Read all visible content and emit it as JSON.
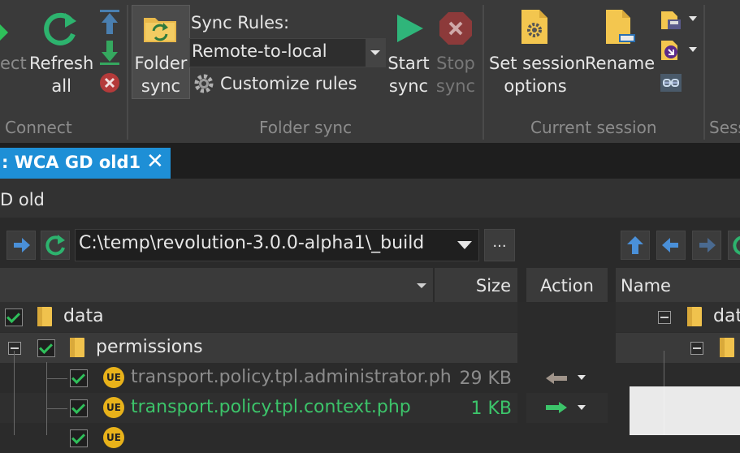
{
  "ribbon": {
    "connect_partial": "ect",
    "refresh_line1": "Refresh",
    "refresh_line2": "all",
    "folder_sync_line1": "Folder",
    "folder_sync_line2": "sync",
    "sync_rules_label": "Sync Rules:",
    "sync_rules_value": "Remote-to-local",
    "customize_rules": "Customize rules",
    "start_sync_line1": "Start",
    "start_sync_line2": "sync",
    "stop_sync_line1": "Stop",
    "stop_sync_line2": "sync",
    "set_session_line1": "Set session",
    "set_session_line2": "options",
    "rename_label": "Rename",
    "groups": {
      "connect": "Connect",
      "folder_sync": "Folder sync",
      "current_session": "Current session",
      "session_partial": "Sess"
    }
  },
  "tab": {
    "title": ": WCA GD old1",
    "close": "✕"
  },
  "panel_title": "D old",
  "left_panel": {
    "path": "C:\\temp\\revolution-3.0.0-alpha1\\_build",
    "ellipsis": "..."
  },
  "columns": {
    "size": "Size",
    "action": "Action",
    "name": "Name"
  },
  "rows": [
    {
      "name": "data"
    },
    {
      "name": "permissions"
    },
    {
      "name": "transport.policy.tpl.administrator.ph",
      "size": "29 KB"
    },
    {
      "name": "transport.policy.tpl.context.php",
      "size": "1 KB"
    }
  ],
  "right_panel": {
    "row0_name": "dat"
  },
  "colors": {
    "accent": "#1e8fd6",
    "check": "#2fbf5a",
    "sync_text": "#3cc46a",
    "folder": "#f0c24d"
  }
}
